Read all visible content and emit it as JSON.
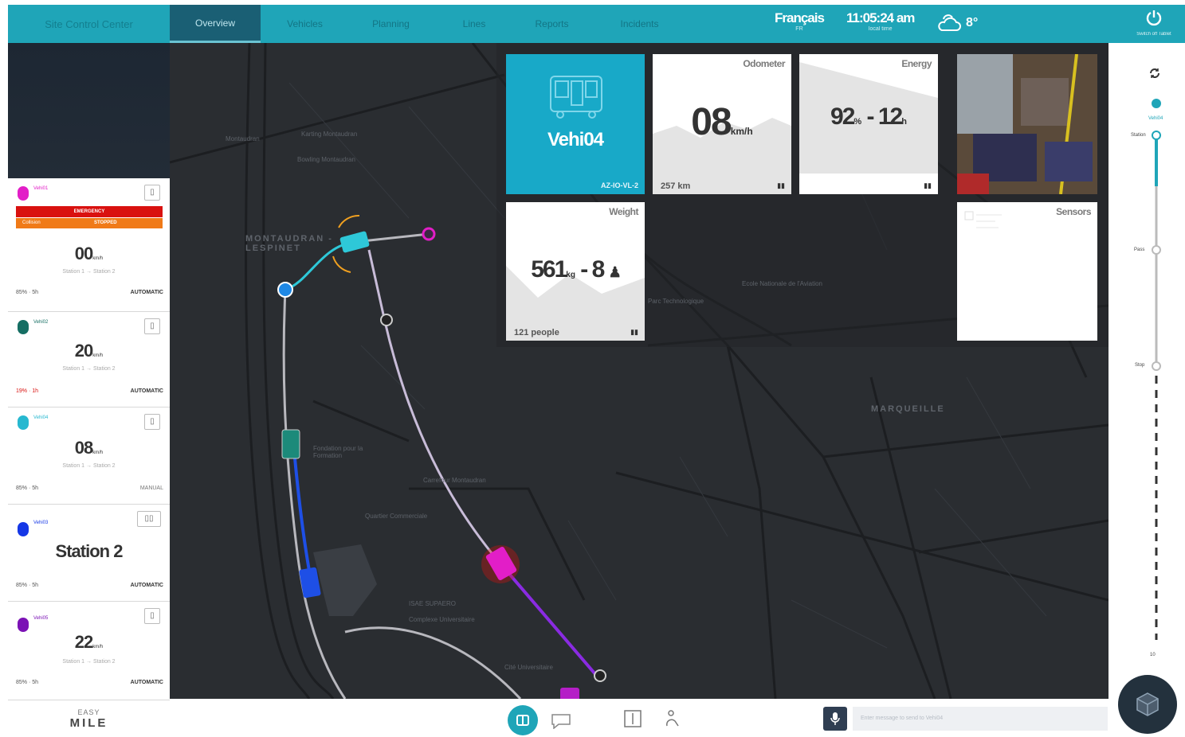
{
  "topbar": {
    "brand": "Site Control Center",
    "tabs": [
      "Overview",
      "Vehicles",
      "Planning",
      "Lines",
      "Reports",
      "Incidents"
    ],
    "active_tab": "Overview",
    "language": "Français",
    "language_sub": "FR",
    "time": "11:05:24 am",
    "time_sub": "local time",
    "temperature": "8°",
    "power_label": "Switch off Tablet"
  },
  "vehicles": [
    {
      "name": "Vehi01",
      "color": "#e21ec7",
      "speed": "00",
      "unit": "km/h",
      "route": "Station 1 → Station 2",
      "battery": "85% · 5h",
      "mode": "AUTOMATIC",
      "alert_title": "EMERGENCY",
      "alert_detail": "Collision",
      "alert_status": "STOPPED"
    },
    {
      "name": "Vehi02",
      "color": "#156e63",
      "speed": "20",
      "unit": "km/h",
      "route": "Station 1 → Station 2",
      "battery": "19% · 1h",
      "mode": "AUTOMATIC"
    },
    {
      "name": "Vehi04",
      "color": "#27b8d0",
      "speed": "08",
      "unit": "km/h",
      "route": "Station 1 → Station 2",
      "battery": "85% · 5h",
      "mode": "MANUAL"
    },
    {
      "name": "Vehi03",
      "color": "#1537e6",
      "station": "Station 2",
      "battery": "85% · 5h",
      "mode": "AUTOMATIC"
    },
    {
      "name": "Vehi05",
      "color": "#7b12b5",
      "speed": "22",
      "unit": "km/h",
      "route": "Station 1 → Station 2",
      "battery": "85% · 5h",
      "mode": "AUTOMATIC"
    }
  ],
  "logo": {
    "line1": "EASY",
    "line2": "MILE"
  },
  "map": {
    "labels": [
      "Karting Montaudran",
      "Bowling Montaudran",
      "Montaudran",
      "Fondation pour la Formation",
      "Quartier Commerciale",
      "Carrefour Montaudran",
      "ISAE SUPAERO",
      "Ecole Nationale de l'Aviation",
      "Complexe Universitaire",
      "Cité Universitaire",
      "Parc Technologique"
    ],
    "cities": [
      "MONTAUDRAN - LESPINET",
      "MARQUEILLE"
    ]
  },
  "tiles": {
    "vehicle": {
      "name": "Vehi04",
      "sub": "AZ-IO-VL-2"
    },
    "odometer": {
      "title": "Odometer",
      "value": "08",
      "unit": "km/h",
      "foot": "257 km"
    },
    "energy": {
      "title": "Energy",
      "value_pct": "92",
      "value_hours": "12",
      "pct_unit": "%",
      "hours_unit": "h"
    },
    "weight": {
      "title": "Weight",
      "value": "561",
      "unit": "kg",
      "people": "8",
      "foot": "121 people"
    },
    "sensors": {
      "title": "Sensors"
    }
  },
  "right_panel": {
    "labels": [
      "Vehi04",
      "Station",
      "Pass",
      "Stop",
      "10"
    ]
  },
  "bottombar": {
    "message_placeholder": "Enter message to send to Vehi04"
  },
  "colors": {
    "accent": "#1fa5b8",
    "danger": "#d9110f",
    "warning": "#f07a18"
  }
}
